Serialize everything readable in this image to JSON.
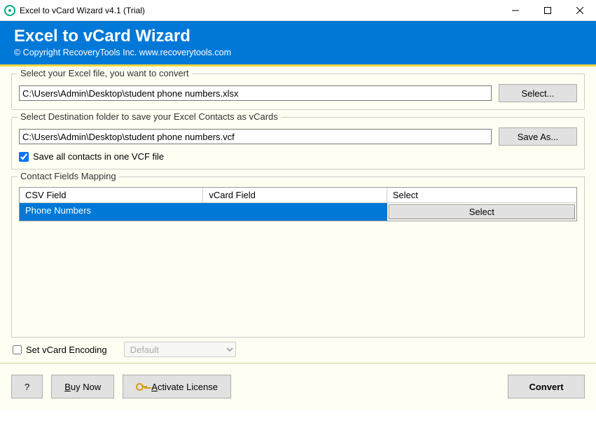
{
  "titlebar": {
    "title": "Excel to vCard Wizard v4.1 (Trial)"
  },
  "header": {
    "title": "Excel to vCard Wizard",
    "copyright": "© Copyright RecoveryTools Inc. www.recoverytools.com"
  },
  "source": {
    "legend": "Select your Excel file, you want to convert",
    "path": "C:\\Users\\Admin\\Desktop\\student phone numbers.xlsx",
    "button": "Select..."
  },
  "dest": {
    "legend": "Select Destination folder to save your Excel Contacts as vCards",
    "path": "C:\\Users\\Admin\\Desktop\\student phone numbers.vcf",
    "button": "Save As...",
    "checkbox": "Save all contacts in one VCF file"
  },
  "mapping": {
    "legend": "Contact Fields Mapping",
    "headers": {
      "c1": "CSV Field",
      "c2": "vCard Field",
      "c3": "Select"
    },
    "row": {
      "csv": "Phone Numbers",
      "vcard": "",
      "select_btn": "Select"
    }
  },
  "encoding": {
    "label": "Set vCard Encoding",
    "value": "Default"
  },
  "footer": {
    "help": "?",
    "buy": "Buy Now",
    "activate": "Activate License",
    "convert": "Convert"
  }
}
